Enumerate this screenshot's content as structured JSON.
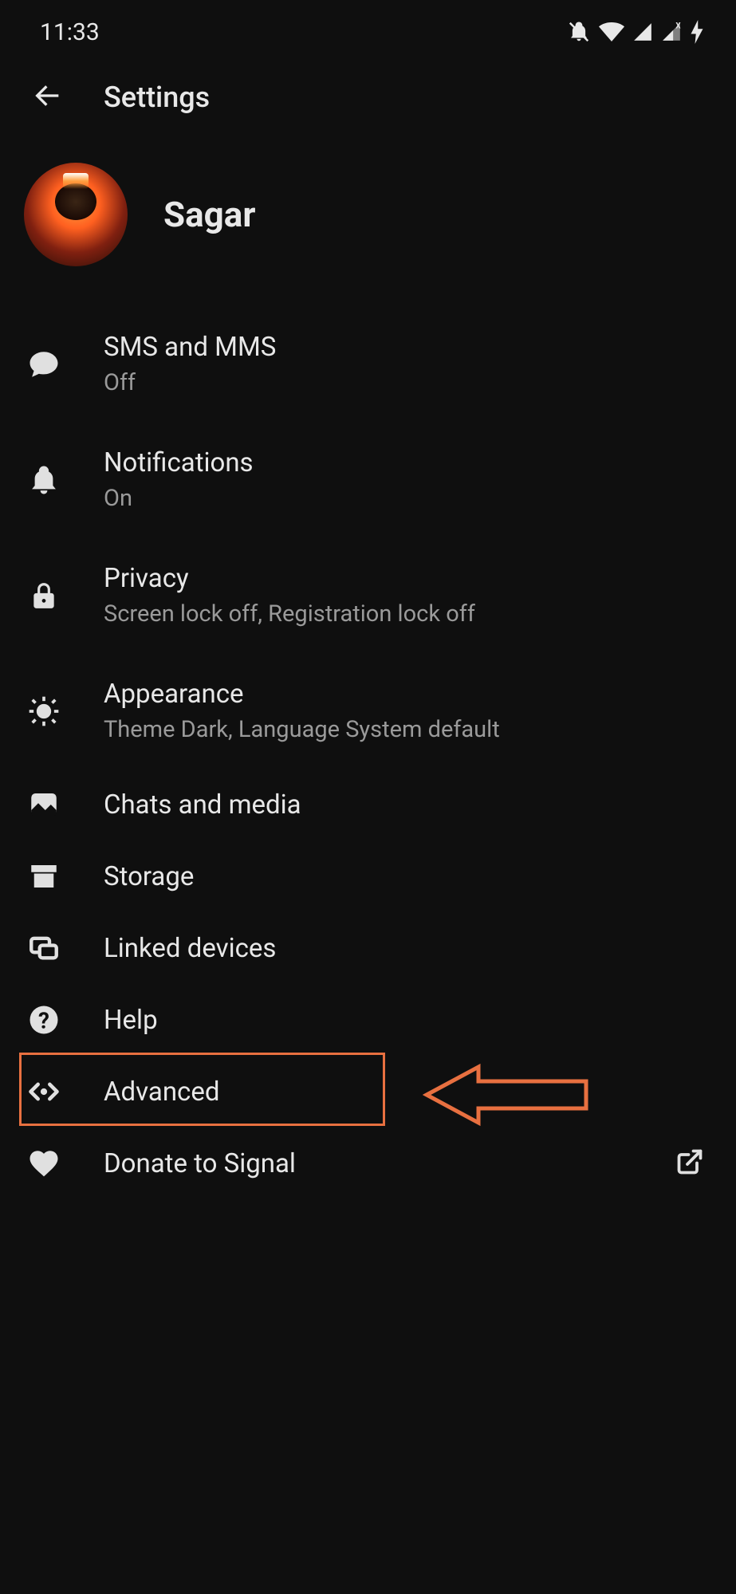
{
  "status": {
    "time": "11:33"
  },
  "header": {
    "title": "Settings"
  },
  "profile": {
    "name": "Sagar"
  },
  "menu": {
    "sms": {
      "title": "SMS and MMS",
      "subtitle": "Off"
    },
    "notifications": {
      "title": "Notifications",
      "subtitle": "On"
    },
    "privacy": {
      "title": "Privacy",
      "subtitle": "Screen lock off, Registration lock off"
    },
    "appearance": {
      "title": "Appearance",
      "subtitle": "Theme Dark, Language System default"
    },
    "chats": {
      "title": "Chats and media"
    },
    "storage": {
      "title": "Storage"
    },
    "linked": {
      "title": "Linked devices"
    },
    "help": {
      "title": "Help"
    },
    "advanced": {
      "title": "Advanced"
    },
    "donate": {
      "title": "Donate to Signal"
    }
  }
}
